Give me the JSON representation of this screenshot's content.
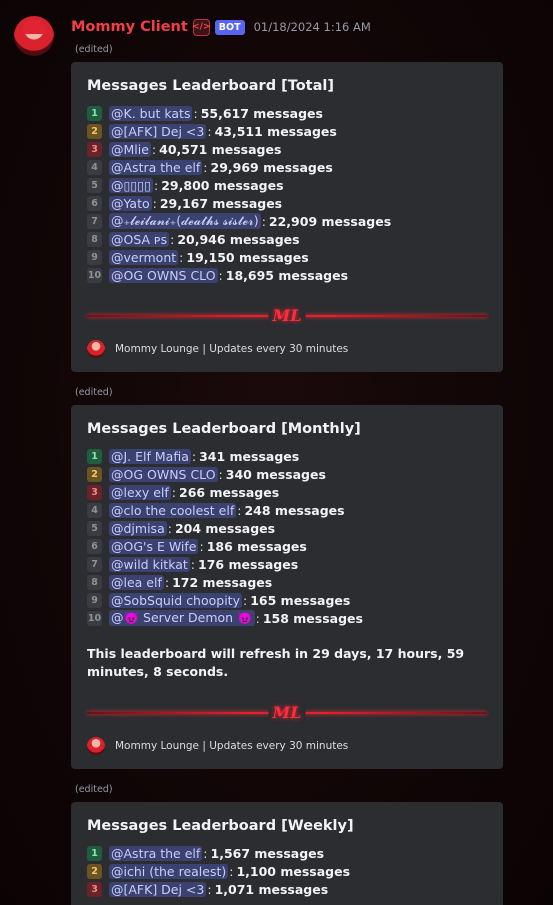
{
  "author": {
    "name": "Mommy Client",
    "dev_badge": "</>",
    "bot_tag": "BOT",
    "timestamp": "01/18/2024 1:16 AM"
  },
  "edited_label": "(edited)",
  "embeds": [
    {
      "title": "Messages Leaderboard [Total]",
      "rows": [
        {
          "rank": "1",
          "user": "@K. but kats",
          "count": "55,617 messages"
        },
        {
          "rank": "2",
          "user": "@[AFK] Dej <3",
          "count": "43,511 messages"
        },
        {
          "rank": "3",
          "user": "@Mlie",
          "count": "40,571 messages"
        },
        {
          "rank": "4",
          "user": "@Astra the elf",
          "count": "29,969 messages"
        },
        {
          "rank": "5",
          "user": "@▯▯▯▯",
          "count": "29,800 messages"
        },
        {
          "rank": "6",
          "user": "@Yato",
          "count": "29,167 messages"
        },
        {
          "rank": "7",
          "user": "@₊𝓵𝓮𝓲𝓵𝓪𝓷𝓲₊(𝓭𝓮𝓪𝓽𝓱𝓼 𝓼𝓲𝓼𝓽𝓮𝓻)",
          "count": "22,909 messages"
        },
        {
          "rank": "8",
          "user": "@OSA ᴘꜱ",
          "count": "20,946 messages"
        },
        {
          "rank": "9",
          "user": "@vermont",
          "count": "19,150 messages"
        },
        {
          "rank": "10",
          "user": "@OG OWNS CLO",
          "count": "18,695 messages"
        }
      ],
      "refresh": "",
      "divider_logo": "ML",
      "footer": "Mommy Lounge | Updates every 30 minutes"
    },
    {
      "title": "Messages Leaderboard [Monthly]",
      "rows": [
        {
          "rank": "1",
          "user": "@J. Elf Mafia",
          "count": "341 messages"
        },
        {
          "rank": "2",
          "user": "@OG OWNS CLO",
          "count": "340 messages"
        },
        {
          "rank": "3",
          "user": "@lexy elf",
          "count": "266 messages"
        },
        {
          "rank": "4",
          "user": "@clo the coolest elf",
          "count": "248 messages"
        },
        {
          "rank": "5",
          "user": "@djmisa",
          "count": "204 messages"
        },
        {
          "rank": "6",
          "user": "@OG's E Wife",
          "count": "186 messages"
        },
        {
          "rank": "7",
          "user": "@wild kitkat",
          "count": "176 messages"
        },
        {
          "rank": "8",
          "user": "@lea elf",
          "count": "172 messages"
        },
        {
          "rank": "9",
          "user": "@SobSquid choopity",
          "count": "165 messages"
        },
        {
          "rank": "10",
          "user": "@👿 Server Demon 👿",
          "count": "158 messages"
        }
      ],
      "refresh": "This leaderboard will refresh in 29 days, 17 hours, 59 minutes, 8 seconds.",
      "divider_logo": "ML",
      "footer": "Mommy Lounge | Updates every 30 minutes"
    },
    {
      "title": "Messages Leaderboard [Weekly]",
      "rows": [
        {
          "rank": "1",
          "user": "@Astra the elf",
          "count": "1,567 messages"
        },
        {
          "rank": "2",
          "user": "@ichi (the realest)",
          "count": "1,100 messages"
        },
        {
          "rank": "3",
          "user": "@[AFK] Dej <3",
          "count": "1,071 messages"
        }
      ],
      "refresh": "",
      "divider_logo": "",
      "footer": ""
    }
  ]
}
